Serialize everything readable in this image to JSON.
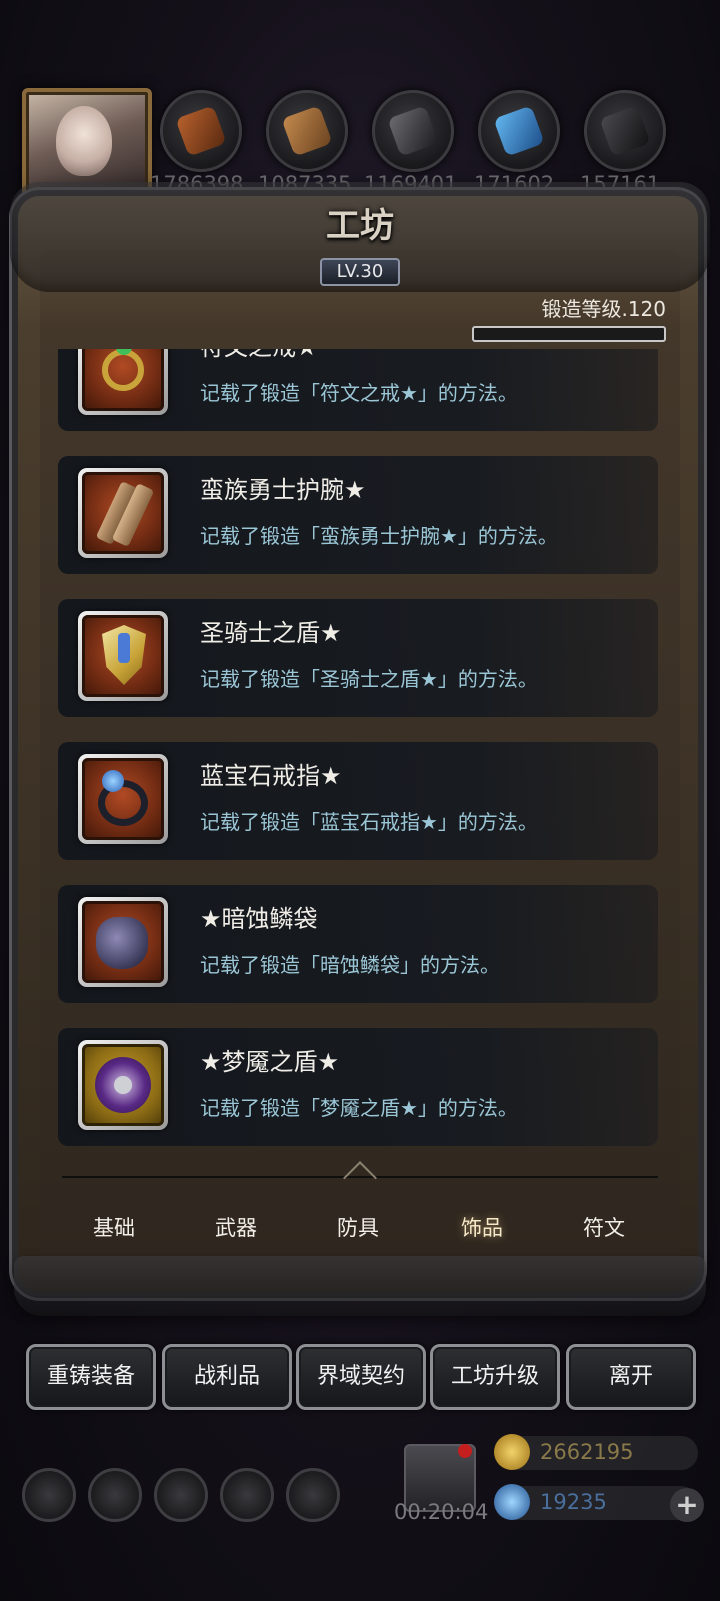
{
  "resources": {
    "values": [
      "1786398",
      "1087335",
      "1169401",
      "171602",
      "157161"
    ]
  },
  "header": {
    "title": "工坊",
    "level": "LV.30",
    "forge_level_label": "锻造等级.120",
    "forge_progress": 0
  },
  "items": [
    {
      "name": "符文之戒★",
      "desc": "记载了锻造「符文之戒★」的方法。",
      "icon": "rune-ring-icon"
    },
    {
      "name": "蛮族勇士护腕★",
      "desc": "记载了锻造「蛮族勇士护腕★」的方法。",
      "icon": "bracer-icon"
    },
    {
      "name": "圣骑士之盾★",
      "desc": "记载了锻造「圣骑士之盾★」的方法。",
      "icon": "paladin-shield-icon"
    },
    {
      "name": "蓝宝石戒指★",
      "desc": "记载了锻造「蓝宝石戒指★」的方法。",
      "icon": "sapphire-ring-icon"
    },
    {
      "name": "★暗蚀鳞袋",
      "desc": "记载了锻造「暗蚀鳞袋」的方法。",
      "icon": "scale-pouch-icon"
    },
    {
      "name": "★梦魇之盾★",
      "desc": "记载了锻造「梦魇之盾★」的方法。",
      "icon": "nightmare-shield-icon"
    }
  ],
  "tabs": [
    "基础",
    "武器",
    "防具",
    "饰品",
    "符文"
  ],
  "active_tab": "饰品",
  "buttons": [
    "重铸装备",
    "战利品",
    "界域契约",
    "工坊升级",
    "离开"
  ],
  "footer": {
    "timer": "00:20:04",
    "gold": "2662195",
    "gems": "19235",
    "plus": "+"
  },
  "colors": {
    "desc_text": "#9bc6d6",
    "gold_text": "#8a7a4a",
    "gem_text": "#4a6f9c",
    "active_tab": "#f6e9c8"
  }
}
